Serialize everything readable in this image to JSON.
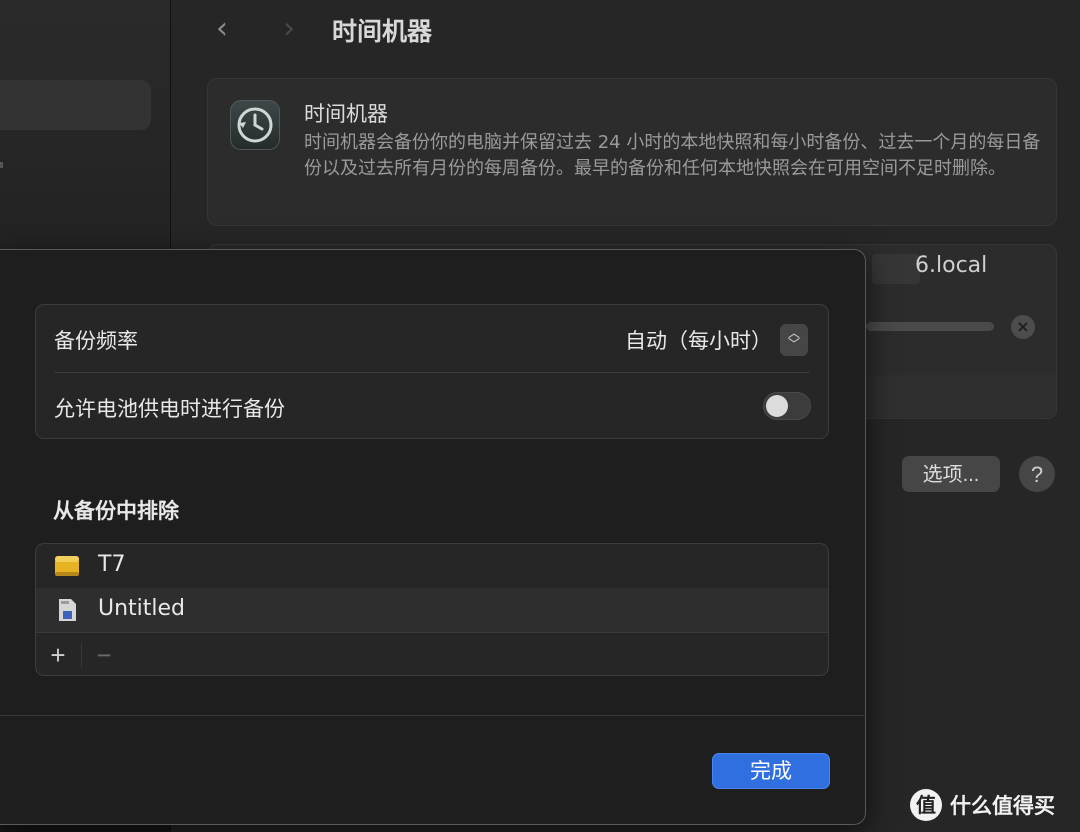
{
  "window": {
    "title": "时间机器",
    "back_glyph": "‹",
    "forward_glyph": "›"
  },
  "intro": {
    "icon": "time-machine-icon",
    "title": "时间机器",
    "description": "时间机器会备份你的电脑并保留过去 24 小时的本地快照和每小时备份、过去一个月的每日备份以及过去所有月份的每周备份。最早的备份和任何本地快照会在可用空间不足时删除。"
  },
  "backup_disk": {
    "host_suffix": "6.local",
    "progress": 0.0,
    "stop_glyph": "×"
  },
  "footer": {
    "options_label": "选项...",
    "help_glyph": "?"
  },
  "sheet": {
    "frequency_label": "备份频率",
    "frequency_value": "自动（每小时）",
    "battery_label": "允许电池供电时进行备份",
    "battery_enabled": false,
    "exclude_title": "从备份中排除",
    "excluded": [
      {
        "name": "T7",
        "icon": "external-drive-icon"
      },
      {
        "name": "Untitled",
        "icon": "sd-card-icon"
      }
    ],
    "add_glyph": "+",
    "remove_glyph": "−",
    "done_label": "完成"
  },
  "watermark": {
    "badge": "值",
    "text": "什么值得买"
  },
  "colors": {
    "accent": "#2f6fe0",
    "drive_yellow": "#e6b422"
  }
}
